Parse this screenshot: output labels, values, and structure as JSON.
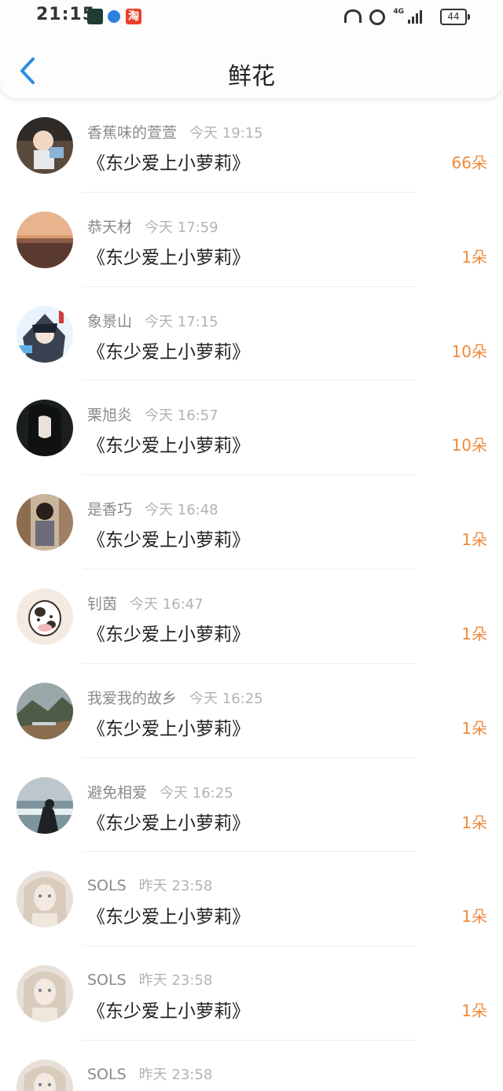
{
  "status_bar": {
    "time": "21:15",
    "app_badge_3": "淘",
    "network": "4G",
    "battery": "44"
  },
  "header": {
    "title": "鲜花"
  },
  "colors": {
    "accent_blue": "#2e8ee6",
    "flower_orange": "#f08a3c"
  },
  "rows": [
    {
      "user": "香蕉味的萱萱",
      "time": "今天 19:15",
      "book": "《东少爱上小萝莉》",
      "count": "66朵",
      "avatar": "boy-photo"
    },
    {
      "user": "恭天材",
      "time": "今天 17:59",
      "book": "《东少爱上小萝莉》",
      "count": "1朵",
      "avatar": "sunset"
    },
    {
      "user": "象景山",
      "time": "今天 17:15",
      "book": "《东少爱上小萝莉》",
      "count": "10朵",
      "avatar": "anime-boy"
    },
    {
      "user": "栗旭炎",
      "time": "今天 16:57",
      "book": "《东少爱上小萝莉》",
      "count": "10朵",
      "avatar": "anime-girl"
    },
    {
      "user": "是香巧",
      "time": "今天 16:48",
      "book": "《东少爱上小萝莉》",
      "count": "1朵",
      "avatar": "girl-photo"
    },
    {
      "user": "钊茵",
      "time": "今天 16:47",
      "book": "《东少爱上小萝莉》",
      "count": "1朵",
      "avatar": "cartoon-cow"
    },
    {
      "user": "我爱我的故乡",
      "time": "今天 16:25",
      "book": "《东少爱上小萝莉》",
      "count": "1朵",
      "avatar": "landscape"
    },
    {
      "user": "避免相爱",
      "time": "今天 16:25",
      "book": "《东少爱上小萝莉》",
      "count": "1朵",
      "avatar": "sea"
    },
    {
      "user": "SOLS",
      "time": "昨天 23:58",
      "book": "《东少爱上小萝莉》",
      "count": "1朵",
      "avatar": "doll"
    },
    {
      "user": "SOLS",
      "time": "昨天 23:58",
      "book": "《东少爱上小萝莉》",
      "count": "1朵",
      "avatar": "doll"
    },
    {
      "user": "SOLS",
      "time": "昨天 23:58",
      "book": "",
      "count": "",
      "avatar": "doll"
    }
  ]
}
